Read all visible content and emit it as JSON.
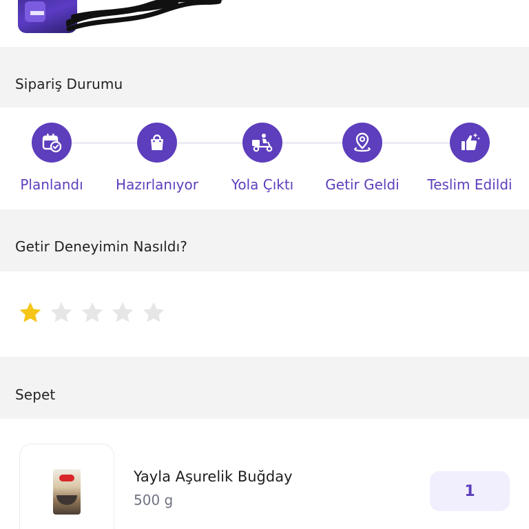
{
  "colors": {
    "brand": "#5d3ebc",
    "section_bg": "#f3f3f3",
    "star_active": "#f5c518",
    "star_inactive": "#e6e6e6"
  },
  "order_status": {
    "title": "Sipariş Durumu",
    "steps": [
      {
        "label": "Planlandı",
        "icon": "calendar-check-icon"
      },
      {
        "label": "Hazırlanıyor",
        "icon": "shopping-bag-icon"
      },
      {
        "label": "Yola Çıktı",
        "icon": "delivery-scooter-icon"
      },
      {
        "label": "Getir Geldi",
        "icon": "location-pin-icon"
      },
      {
        "label": "Teslim Edildi",
        "icon": "thumbs-up-icon"
      }
    ]
  },
  "rating": {
    "title": "Getir Deneyimin Nasıldı?",
    "value": 1,
    "max": 5
  },
  "cart": {
    "title": "Sepet",
    "items": [
      {
        "name": "Yayla Aşurelik Buğday",
        "size": "500 g",
        "quantity": "1"
      }
    ]
  }
}
